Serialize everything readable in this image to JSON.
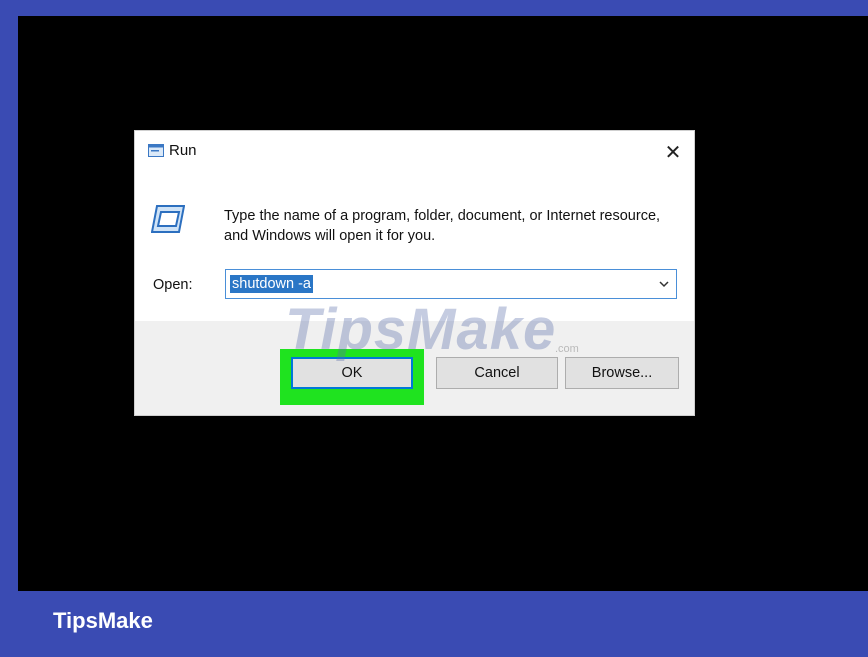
{
  "dialog": {
    "title": "Run",
    "title_icon": "run-icon",
    "close_glyph": "✕",
    "instructions": "Type the name of a program, folder, document, or Internet resource, and Windows will open it for you.",
    "open_label": "Open:",
    "open_value": "shutdown -a",
    "buttons": {
      "ok": "OK",
      "cancel": "Cancel",
      "browse": "Browse..."
    }
  },
  "watermark": {
    "text": "TipsMake",
    "suffix": ".com"
  },
  "footer": {
    "brand": "TipsMake"
  },
  "colors": {
    "frame": "#3a4bb3",
    "highlight": "#1fe31f",
    "selection": "#2a76c6"
  }
}
